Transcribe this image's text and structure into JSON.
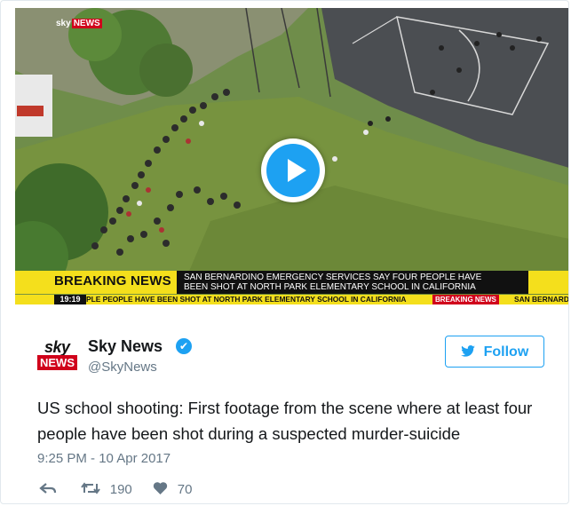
{
  "video": {
    "channel_logo": {
      "sky": "sky",
      "news": "NEWS"
    },
    "breaking_label": "BREAKING NEWS",
    "headline_line1": "SAN BERNARDINO EMERGENCY SERVICES SAY FOUR PEOPLE HAVE",
    "headline_line2": "BEEN SHOT AT NORTH PARK ELEMENTARY SCHOOL IN CALIFORNIA",
    "ticker_time": "19:19",
    "ticker_text": "PLE PEOPLE HAVE BEEN SHOT AT NORTH PARK ELEMENTARY SCHOOL IN CALIFORNIA",
    "ticker_badge": "BREAKING NEWS",
    "ticker_text2": "SAN BERNARD",
    "play_icon": "play-icon",
    "accent": "#1da1f2",
    "ticker_yellow": "#f4df1c"
  },
  "author": {
    "avatar_sky": "sky",
    "avatar_news": "NEWS",
    "name": "Sky News",
    "handle": "@SkyNews",
    "verified_icon": "✔"
  },
  "follow": {
    "label": "Follow",
    "icon": "twitter-bird-icon"
  },
  "tweet": {
    "text": "US school shooting: First footage from the scene where at least four people have been shot during a suspected murder-suicide",
    "timestamp": "9:25 PM - 10 Apr 2017"
  },
  "actions": {
    "reply_icon": "reply-icon",
    "retweet_icon": "retweet-icon",
    "retweets": "190",
    "like_icon": "heart-icon",
    "likes": "70"
  }
}
